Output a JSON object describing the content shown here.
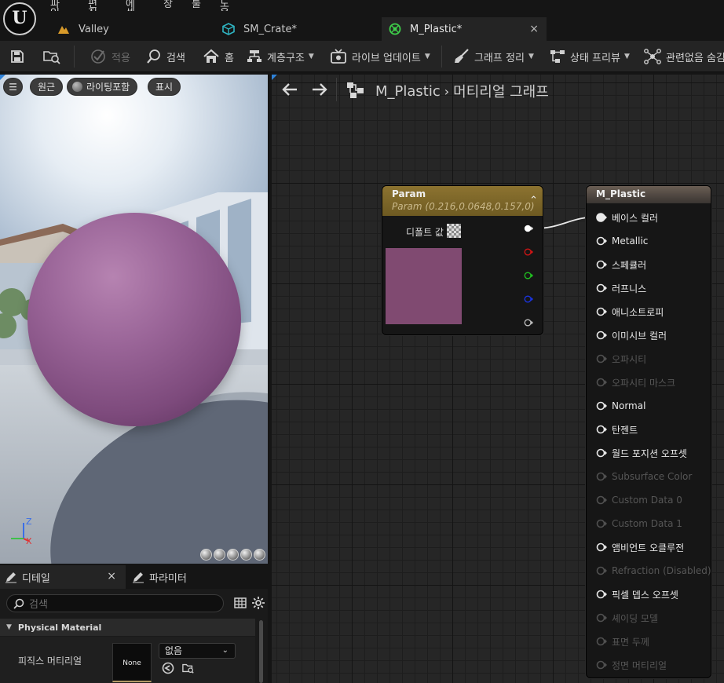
{
  "app": {
    "menu": [
      "파일",
      "편집",
      "에셋",
      "창",
      "툴",
      "도움말"
    ],
    "tabs": [
      {
        "label": "Valley",
        "active": false,
        "icon": "level-icon"
      },
      {
        "label": "SM_Crate*",
        "active": false,
        "icon": "static-mesh-icon"
      },
      {
        "label": "M_Plastic*",
        "active": true,
        "icon": "material-icon"
      }
    ],
    "close_glyph": "×"
  },
  "toolbar": {
    "apply": "적용",
    "search": "검색",
    "home": "홈",
    "hierarchy": "계층구조",
    "live_update": "라이브 업데이트",
    "graph_cleanup": "그래프 정리",
    "state_preview": "상태 프리뷰",
    "hide_unrelated": "관련없음 숨김"
  },
  "viewport": {
    "perspective": "원근",
    "lighting": "라이팅포함",
    "show": "표시",
    "axis": {
      "z": "Z",
      "x": "X"
    }
  },
  "details": {
    "tab_details": "디테일",
    "tab_params": "파라미터",
    "close_glyph": "×",
    "search_placeholder": "검색",
    "category": "Physical Material",
    "property_label": "피직스 머티리얼",
    "thumb_text": "None",
    "dropdown_value": "없음"
  },
  "graph": {
    "breadcrumb_asset": "M_Plastic",
    "breadcrumb_graph": "머티리얼 그래프",
    "param_node": {
      "title": "Param",
      "subtitle": "Param (0.216,0.0648,0.157,0)",
      "default_label": "디폴트 값",
      "swatch_color": "#804a71",
      "pin_colors": [
        "#ffffff",
        "#d01515",
        "#20c020",
        "#1a34e0",
        "#bdbdbd"
      ]
    },
    "material_node": {
      "title": "M_Plastic",
      "inputs": [
        {
          "label": "베이스 컬러",
          "enabled": true,
          "connected": true
        },
        {
          "label": "Metallic",
          "enabled": true,
          "connected": false
        },
        {
          "label": "스페큘러",
          "enabled": true,
          "connected": false
        },
        {
          "label": "러프니스",
          "enabled": true,
          "connected": false
        },
        {
          "label": "애니소트로피",
          "enabled": true,
          "connected": false
        },
        {
          "label": "이미시브 컬러",
          "enabled": true,
          "connected": false
        },
        {
          "label": "오파시티",
          "enabled": false,
          "connected": false
        },
        {
          "label": "오파시티 마스크",
          "enabled": false,
          "connected": false
        },
        {
          "label": "Normal",
          "enabled": true,
          "connected": false
        },
        {
          "label": "탄젠트",
          "enabled": true,
          "connected": false
        },
        {
          "label": "월드 포지션 오프셋",
          "enabled": true,
          "connected": false
        },
        {
          "label": "Subsurface Color",
          "enabled": false,
          "connected": false
        },
        {
          "label": "Custom Data 0",
          "enabled": false,
          "connected": false
        },
        {
          "label": "Custom Data 1",
          "enabled": false,
          "connected": false
        },
        {
          "label": "앰비언트 오클루전",
          "enabled": true,
          "connected": false
        },
        {
          "label": "Refraction (Disabled)",
          "enabled": false,
          "connected": false
        },
        {
          "label": "픽셀 뎁스 오프셋",
          "enabled": true,
          "connected": false
        },
        {
          "label": "셰이딩 모델",
          "enabled": false,
          "connected": false
        },
        {
          "label": "표면 두께",
          "enabled": false,
          "connected": false
        },
        {
          "label": "정면 머티리얼",
          "enabled": false,
          "connected": false
        }
      ]
    }
  },
  "colors": {
    "accent_blue": "#2f82d8",
    "param_header": "#8c7330",
    "material_header": "#6a5e54"
  }
}
